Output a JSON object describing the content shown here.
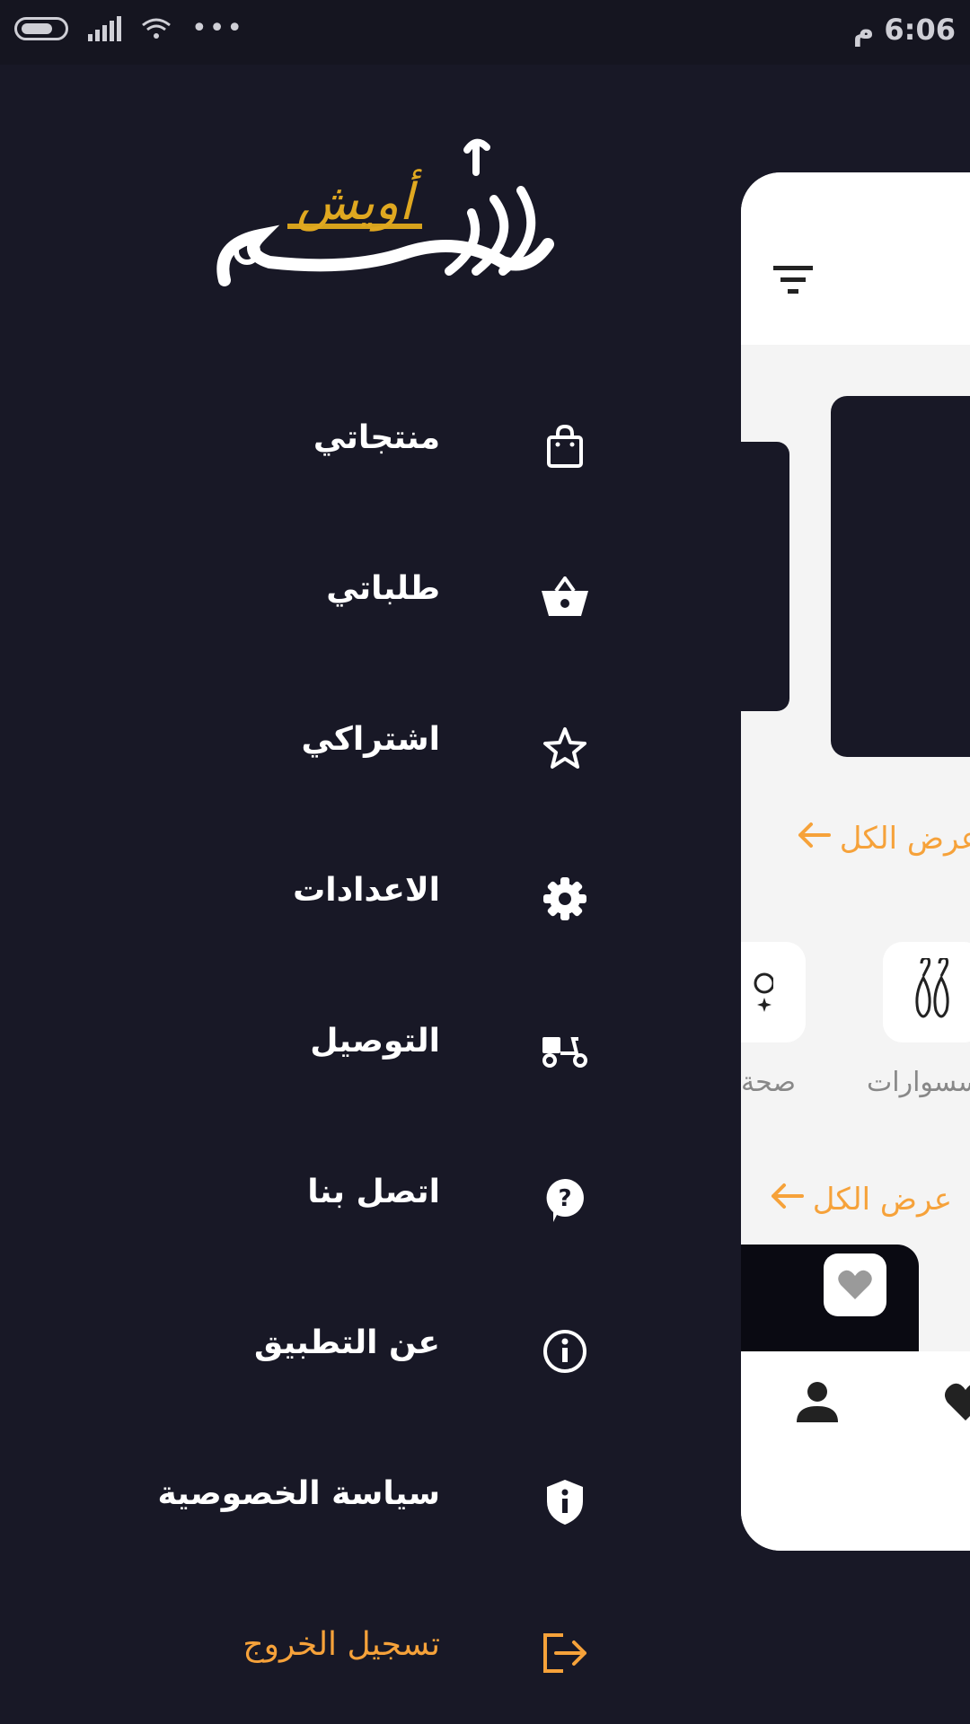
{
  "status_bar": {
    "time": "6:06 م",
    "more_indicator": "•••"
  },
  "drawer": {
    "logo_text": "أويش",
    "menu": [
      {
        "label": "منتجاتي",
        "icon": "shopping-bag-icon"
      },
      {
        "label": "طلباتي",
        "icon": "basket-icon"
      },
      {
        "label": "اشتراكي",
        "icon": "star-outline-icon"
      },
      {
        "label": "الاعدادات",
        "icon": "gear-icon"
      },
      {
        "label": "التوصيل",
        "icon": "delivery-scooter-icon"
      },
      {
        "label": "اتصل بنا",
        "icon": "help-bubble-icon"
      },
      {
        "label": "عن التطبيق",
        "icon": "info-circle-icon"
      },
      {
        "label": "سياسة الخصوصية",
        "icon": "privacy-shield-icon"
      },
      {
        "label": "تسجيل الخروج",
        "icon": "logout-icon"
      }
    ]
  },
  "main": {
    "view_all_1": "عرض الكل",
    "view_all_2": "عرض الكل",
    "categories": [
      {
        "label": "صحة",
        "icon": "health-icon"
      },
      {
        "label": "إكسسوارات",
        "icon": "earrings-icon"
      }
    ]
  },
  "colors": {
    "drawer_bg": "#181826",
    "accent": "#f6a23a",
    "card_bg": "#f4f4f4"
  }
}
